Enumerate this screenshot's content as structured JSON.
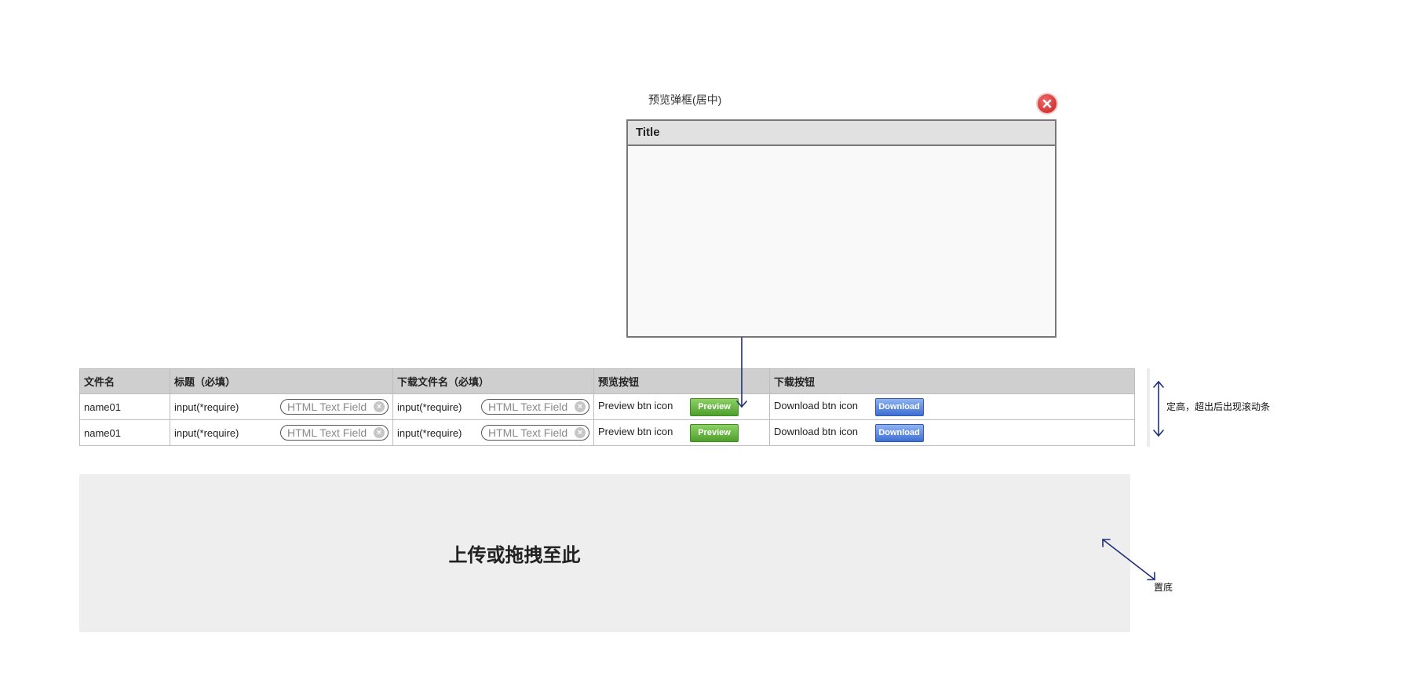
{
  "modal": {
    "caption": "预览弹框(居中)",
    "title": "Title",
    "close_icon": "close-circle-icon"
  },
  "table": {
    "headers": [
      "文件名",
      "标题（必填）",
      "下载文件名（必填）",
      "预览按钮",
      "下载按钮"
    ],
    "rows": [
      {
        "name": "name01",
        "title_label": "input(*require)",
        "title_placeholder": "HTML Text Field",
        "download_label": "input(*require)",
        "download_placeholder": "HTML Text Field",
        "preview_label": "Preview btn icon",
        "preview_button": "Preview",
        "download_btn_label": "Download btn icon",
        "download_button": "Download"
      },
      {
        "name": "name01",
        "title_label": "input(*require)",
        "title_placeholder": "HTML Text Field",
        "download_label": "input(*require)",
        "download_placeholder": "HTML Text Field",
        "preview_label": "Preview btn icon",
        "preview_button": "Preview",
        "download_btn_label": "Download btn icon",
        "download_button": "Download"
      }
    ]
  },
  "annotations": {
    "scroll_note": "定高，超出后出现滚动条",
    "bottom_note": "置底"
  },
  "upload": {
    "label": "上传或拖拽至此"
  },
  "colors": {
    "preview_button": "#5aaa35",
    "download_button": "#4a7bd9",
    "arrow": "#1f2f7a"
  }
}
